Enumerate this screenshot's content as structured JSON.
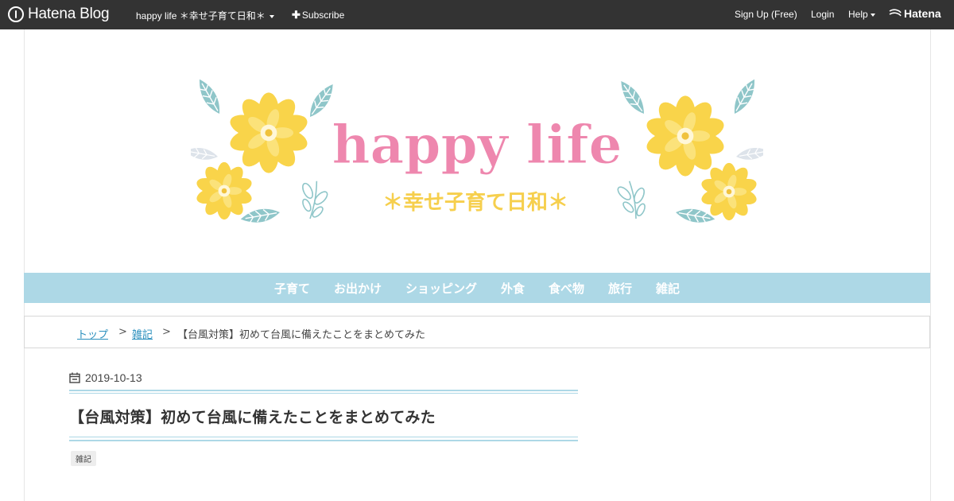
{
  "topbar": {
    "logo_text": "Hatena Blog",
    "blog_name": "happy life ＊幸せ子育て日和＊",
    "subscribe_label": "Subscribe",
    "signup_label": "Sign Up (Free)",
    "login_label": "Login",
    "help_label": "Help",
    "hatena_label": "Hatena"
  },
  "header": {
    "title": "happy life",
    "subtitle": "＊幸せ子育て日和＊"
  },
  "nav": {
    "items": [
      "子育て",
      "お出かけ",
      "ショッピング",
      "外食",
      "食べ物",
      "旅行",
      "雑記"
    ]
  },
  "breadcrumb": {
    "top_label": "トップ",
    "category_label": "雑記",
    "separator": ">",
    "current_label": "【台風対策】初めて台風に備えたことをまとめてみた"
  },
  "article": {
    "date": "2019-10-13",
    "title": "【台風対策】初めて台風に備えたことをまとめてみた",
    "tag": "雑記"
  },
  "colors": {
    "topbar_bg": "#333333",
    "nav_bg": "#add8e6",
    "title_pink": "#ee87ae",
    "subtitle_yellow": "#f6cf4d",
    "leaf_teal": "#8fc6c9",
    "flower_yellow": "#f9d44a",
    "link_blue": "#2a8fbd"
  }
}
